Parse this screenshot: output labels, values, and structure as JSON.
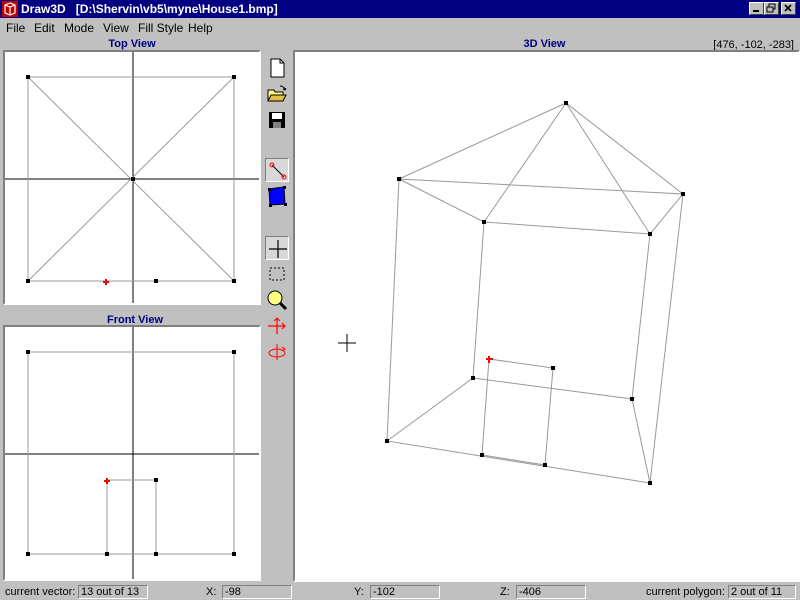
{
  "window": {
    "app_name": "Draw3D",
    "file_path": "[D:\\Shervin\\vb5\\myne\\House1.bmp]",
    "controls": [
      "minimize-icon",
      "restore-icon",
      "close-icon"
    ]
  },
  "menu": [
    "File",
    "Edit",
    "Mode",
    "View",
    "Fill Style",
    "Help"
  ],
  "views": {
    "top": "Top View",
    "front": "Front View",
    "three_d": "3D View"
  },
  "cursor_coords": "[476, -102, -283]",
  "toolbar": {
    "tools": [
      "new-file-icon",
      "open-folder-icon",
      "save-icon",
      "line-tool-icon",
      "polygon-fill-icon",
      "crosshair-icon",
      "select-rect-icon",
      "zoom-icon",
      "move-icon",
      "rotate-icon"
    ],
    "active_tool": "crosshair-icon",
    "colors": {
      "selected_point": "#ff0000",
      "fill": "#0000ff",
      "title_blue": "#000080"
    }
  },
  "status": {
    "vector_label": "current vector:",
    "vector_value": "13   out of 13",
    "x_label": "X:",
    "x_value": "-98",
    "y_label": "Y:",
    "y_value": "-102",
    "z_label": "Z:",
    "z_value": "-406",
    "polygon_label": "current polygon:",
    "polygon_value": "2   out of 11"
  }
}
